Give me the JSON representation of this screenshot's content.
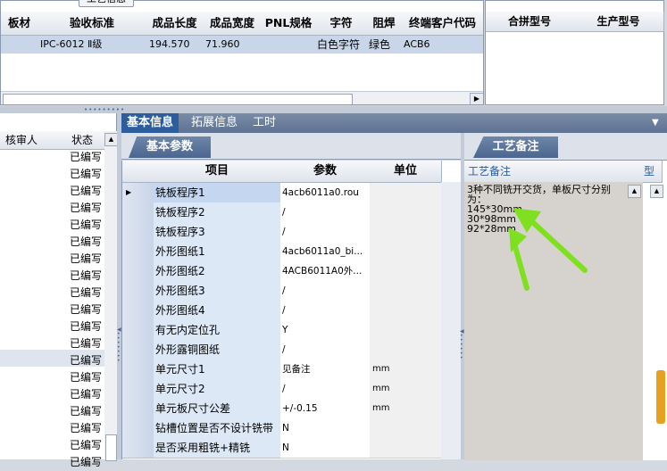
{
  "top_button": "工艺信息",
  "top_grid": {
    "headers": [
      "板材",
      "验收标准",
      "成品长度",
      "成品宽度",
      "PNL规格",
      "字符",
      "阻焊",
      "终端客户代码"
    ],
    "row": {
      "standard": "IPC-6012 Ⅱ级",
      "length": "194.570",
      "width": "71.960",
      "pnl": "",
      "char": "白色字符",
      "mask": "绿色",
      "customer": "ACB6"
    }
  },
  "right_top_headers": [
    "合拼型号",
    "生产型号"
  ],
  "left_panel": {
    "headers": [
      "核审人",
      "状态"
    ],
    "status_rows": [
      "已编写",
      "已编写",
      "已编写",
      "已编写",
      "已编写",
      "已编写",
      "已编写",
      "已编写",
      "已编写",
      "已编写",
      "已编写",
      "已编写",
      "已编写",
      "已编写",
      "已编写",
      "已编写",
      "已编写",
      "已编写",
      "已编写"
    ]
  },
  "tabs": [
    "基本信息",
    "拓展信息",
    "工时"
  ],
  "tabs_menu_icon": "dropdown-arrow-icon",
  "subtab_basic": "基本参数",
  "params_grid": {
    "headers": [
      "项目",
      "参数",
      "单位"
    ],
    "rows": [
      {
        "item": "铣板程序1",
        "param": "4acb6011a0.rou",
        "unit": ""
      },
      {
        "item": "铣板程序2",
        "param": "/",
        "unit": ""
      },
      {
        "item": "铣板程序3",
        "param": "/",
        "unit": ""
      },
      {
        "item": "外形图纸1",
        "param": "4acb6011a0_bi...",
        "unit": ""
      },
      {
        "item": "外形图纸2",
        "param": "4ACB6011A0外...",
        "unit": ""
      },
      {
        "item": "外形图纸3",
        "param": "/",
        "unit": ""
      },
      {
        "item": "外形图纸4",
        "param": "/",
        "unit": ""
      },
      {
        "item": "有无内定位孔",
        "param": "Y",
        "unit": ""
      },
      {
        "item": "外形露铜图纸",
        "param": "/",
        "unit": ""
      },
      {
        "item": "单元尺寸1",
        "param": "见备注",
        "unit": "mm"
      },
      {
        "item": "单元尺寸2",
        "param": "/",
        "unit": "mm"
      },
      {
        "item": "单元板尺寸公差",
        "param": "+/-0.15",
        "unit": "mm"
      },
      {
        "item": "钻槽位置是否不设计铣带",
        "param": "N",
        "unit": ""
      },
      {
        "item": "是否采用粗铣+精铣",
        "param": "N",
        "unit": ""
      }
    ]
  },
  "subtab_process": "工艺备注",
  "notes_grid": {
    "headers": [
      "工艺备注",
      "型"
    ],
    "memo": "3种不同铣开交货，单板尺寸分别为：\n145*30mm\n30*98mm\n92*28mm"
  },
  "colors": {
    "tab_active": "#2d5d9c",
    "row_select": "#c9d6ea",
    "arrow": "#7fe020"
  }
}
